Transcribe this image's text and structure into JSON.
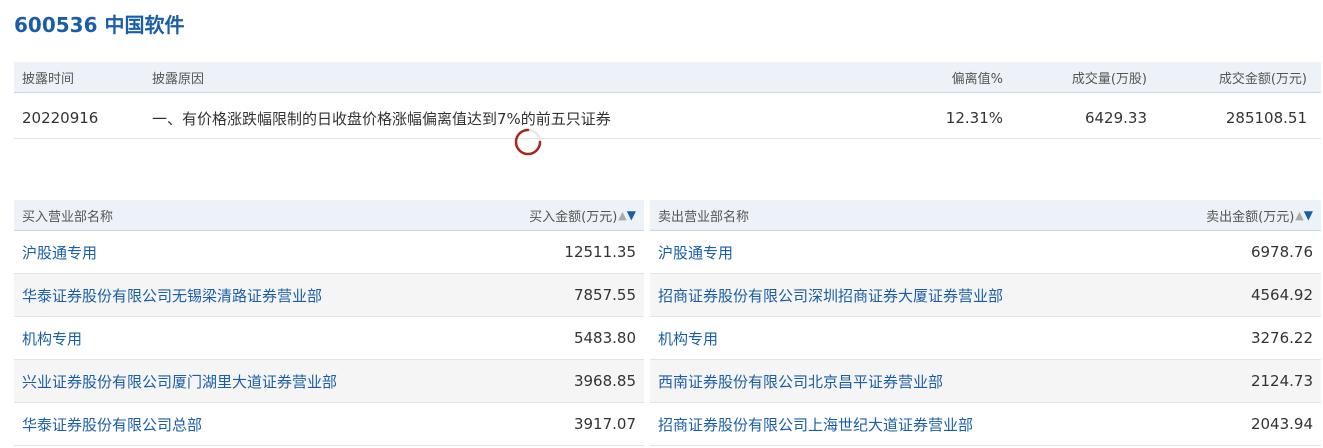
{
  "header": {
    "title": "600536 中国软件"
  },
  "disclosure": {
    "columns": {
      "time": "披露时间",
      "reason": "披露原因",
      "deviation": "偏离值%",
      "volume": "成交量(万股)",
      "amount": "成交金额(万元)"
    },
    "row": {
      "time": "20220916",
      "reason": "一、有价格涨跌幅限制的日收盘价格涨幅偏离值达到7%的前五只证券",
      "deviation": "12.31%",
      "volume": "6429.33",
      "amount": "285108.51"
    }
  },
  "buy": {
    "name_header": "买入营业部名称",
    "amount_header": "买入金额(万元)",
    "sort_up_icon": "sort-ascending-icon",
    "sort_down_icon": "sort-descending-icon",
    "rows": [
      {
        "name": "沪股通专用",
        "amount": "12511.35"
      },
      {
        "name": "华泰证券股份有限公司无锡梁清路证券营业部",
        "amount": "7857.55"
      },
      {
        "name": "机构专用",
        "amount": "5483.80"
      },
      {
        "name": "兴业证券股份有限公司厦门湖里大道证券营业部",
        "amount": "3968.85"
      },
      {
        "name": "华泰证券股份有限公司总部",
        "amount": "3917.07"
      }
    ]
  },
  "sell": {
    "name_header": "卖出营业部名称",
    "amount_header": "卖出金额(万元)",
    "rows": [
      {
        "name": "沪股通专用",
        "amount": "6978.76"
      },
      {
        "name": "招商证券股份有限公司深圳招商证券大厦证券营业部",
        "amount": "4564.92"
      },
      {
        "name": "机构专用",
        "amount": "3276.22"
      },
      {
        "name": "西南证券股份有限公司北京昌平证券营业部",
        "amount": "2124.73"
      },
      {
        "name": "招商证券股份有限公司上海世纪大道证券营业部",
        "amount": "2043.94"
      }
    ]
  },
  "colors": {
    "title": "#1a5ea8",
    "link": "#1a5ea8",
    "header_bg": "#edf2f8",
    "alt_row_bg": "#f5f5f5",
    "spinner": "#a52a1e"
  },
  "loading_indicator": "loading-spinner-icon"
}
